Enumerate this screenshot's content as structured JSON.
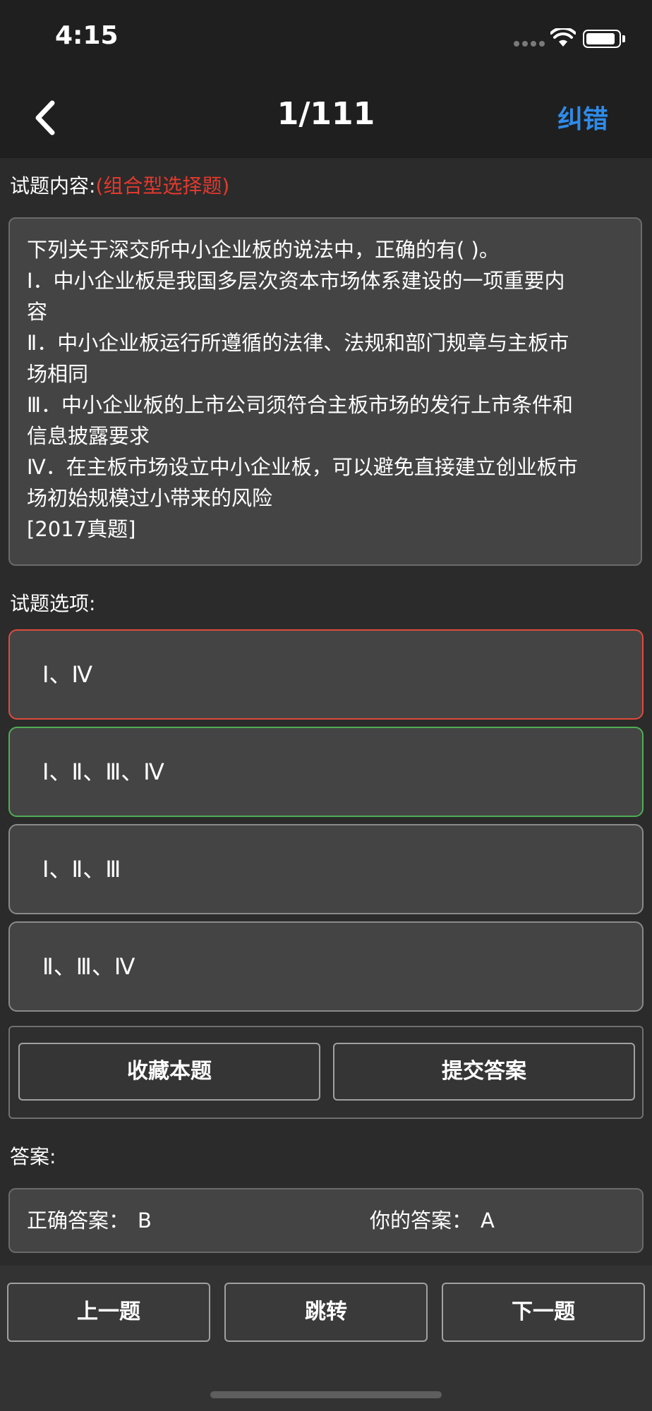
{
  "status_bar": {
    "time": "4:15"
  },
  "nav": {
    "title": "1/111",
    "report_label": "纠错"
  },
  "question": {
    "label": "试题内容:",
    "type_tag": "(组合型选择题)",
    "lines": [
      "下列关于深交所中小企业板的说法中，正确的有( )。",
      "Ⅰ．中小企业板是我国多层次资本市场体系建设的一项重要内",
      "容",
      "Ⅱ．中小企业板运行所遵循的法律、法规和部门规章与主板市",
      "场相同",
      "Ⅲ．中小企业板的上市公司须符合主板市场的发行上市条件和",
      "信息披露要求",
      "Ⅳ．在主板市场设立中小企业板，可以避免直接建立创业板市",
      "场初始规模过小带来的风险",
      "[2017真题]"
    ]
  },
  "options": {
    "label": "试题选项:",
    "items": [
      {
        "text": "Ⅰ、Ⅳ",
        "state": "wrong"
      },
      {
        "text": "Ⅰ、Ⅱ、Ⅲ、Ⅳ",
        "state": "correct"
      },
      {
        "text": "Ⅰ、Ⅱ、Ⅲ",
        "state": "normal"
      },
      {
        "text": "Ⅱ、Ⅲ、Ⅳ",
        "state": "normal"
      }
    ]
  },
  "actions": {
    "favorite_label": "收藏本题",
    "submit_label": "提交答案"
  },
  "answer": {
    "label": "答案:",
    "correct_label": "正确答案：",
    "correct_value": "B",
    "yours_label": "你的答案：",
    "yours_value": "A"
  },
  "bottom_nav": {
    "prev_label": "上一题",
    "jump_label": "跳转",
    "next_label": "下一题"
  },
  "colors": {
    "accent_blue": "#2f8be8",
    "wrong_red": "#e04a3c",
    "correct_green": "#4fae55",
    "type_tag_red": "#e23a2e"
  },
  "icons": {
    "back": "chevron-left-icon",
    "wifi": "wifi-icon",
    "battery": "battery-icon",
    "signal": "cellular-signal-icon"
  }
}
